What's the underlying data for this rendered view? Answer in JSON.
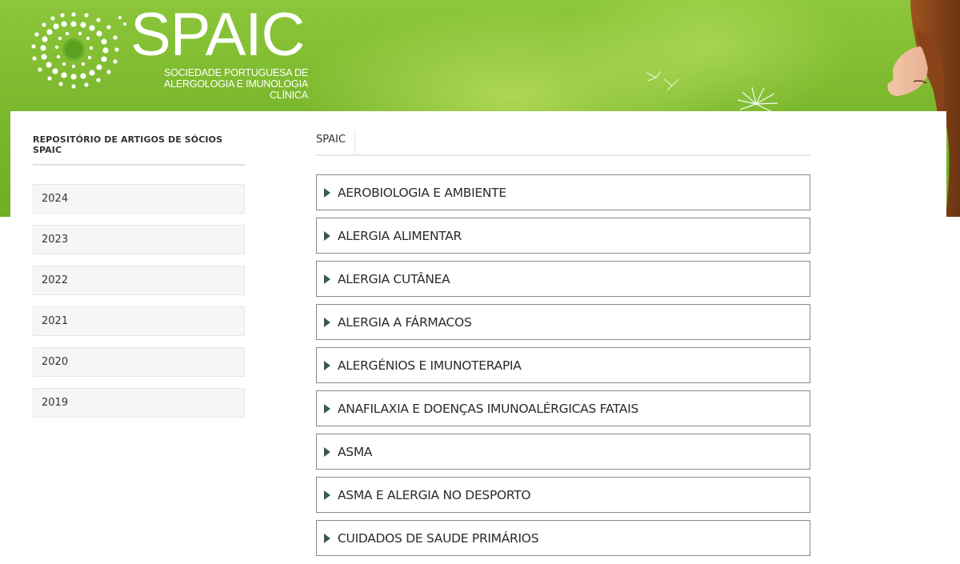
{
  "header": {
    "logo_wordmark": "SPAIC",
    "logo_subtitle_line1": "SOCIEDADE PORTUGUESA DE",
    "logo_subtitle_line2": "ALERGOLOGIA E IMUNOLOGIA CLÍNICA"
  },
  "sidebar": {
    "title": "REPOSITÓRIO DE ARTIGOS DE SÓCIOS SPAIC",
    "years": [
      "2024",
      "2023",
      "2022",
      "2021",
      "2020",
      "2019"
    ]
  },
  "main": {
    "tabs": [
      {
        "label": "SPAIC"
      }
    ],
    "categories": [
      "AEROBIOLOGIA E AMBIENTE",
      "ALERGIA ALIMENTAR",
      "ALERGIA CUTÂNEA",
      "ALERGIA A FÁRMACOS",
      "ALERGÉNIOS E IMUNOTERAPIA",
      "ANAFILAXIA E DOENÇAS IMUNOALÉRGICAS FATAIS",
      "ASMA",
      "ASMA E ALERGIA NO DESPORTO",
      "CUIDADOS DE SAUDE PRIMÁRIOS"
    ]
  },
  "icons": {
    "accordion_arrow": "caret-right-icon",
    "logo_mark": "dotted-ring-logo-icon"
  },
  "colors": {
    "banner_green": "#7cb92e",
    "accordion_border": "#7f8c8c",
    "arrow": "#3b5656",
    "year_bg": "#f6f6f6"
  }
}
